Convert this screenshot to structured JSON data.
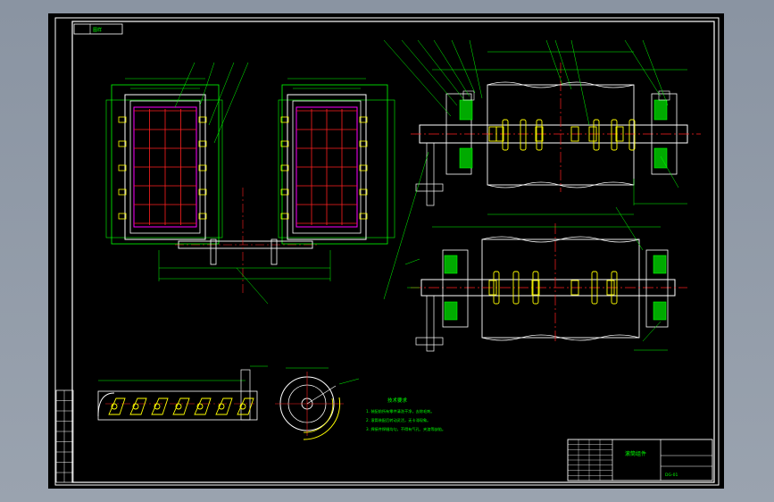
{
  "sheet": {
    "title_block_label": "图样",
    "drawing_name": "滚筒组件",
    "drawing_number": "DG-01"
  },
  "colors": {
    "background": "#000000",
    "frame": "#ffffff",
    "outline": "#ffffff",
    "centerline": "#ff2020",
    "dimension": "#00ff00",
    "part": "#ffff00",
    "highlight": "#ff00ff",
    "accent": "#00ffff"
  },
  "notes": {
    "heading": "技术要求",
    "items": [
      "1. 装配前所有零件清洗干净，去除毛刺。",
      "2. 滚筒装配后转动灵活，无卡滞现象。",
      "3. 焊接件焊缝均匀，不得有气孔、夹渣等缺陷。"
    ]
  }
}
